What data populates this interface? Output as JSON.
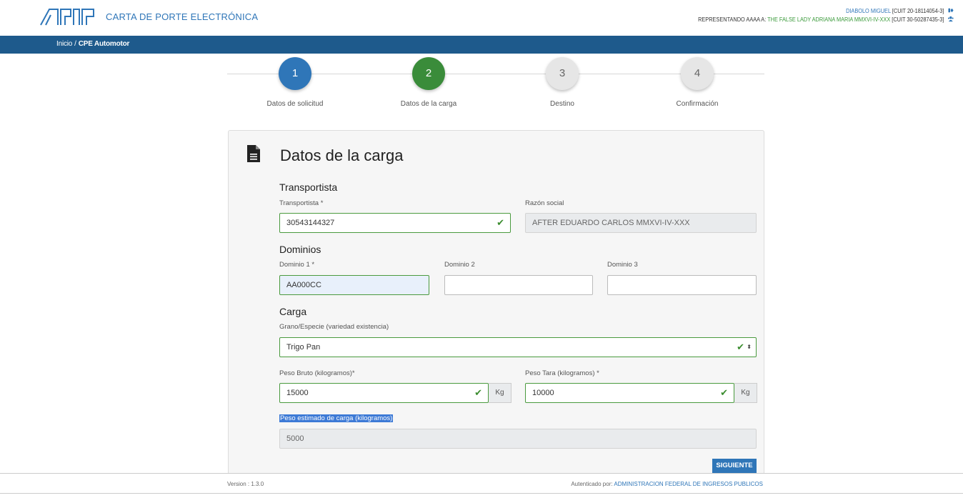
{
  "header": {
    "app_title": "CARTA DE PORTE ELECTRÓNICA",
    "user_name": "DIABOLO MIGUEL",
    "user_cuit": "[CUIT 20-18114054-3]",
    "representing_label": "REPRESENTANDO AAAA A:",
    "represented_name": "THE FALSE LADY ADRIANA MARIA MMXVI-IV-XXX",
    "represented_cuit": "[CUIT 30-50287435-3]",
    "logout_icon": "logout-icon",
    "users_icon": "users-icon"
  },
  "breadcrumb": {
    "home": "Inicio",
    "separator": "/",
    "current": "CPE Automotor"
  },
  "steps": [
    {
      "number": "1",
      "label": "Datos de solicitud",
      "color": "#2f76b8",
      "state": "done"
    },
    {
      "number": "2",
      "label": "Datos de la carga",
      "color": "#3a8c3a",
      "state": "active"
    },
    {
      "number": "3",
      "label": "Destino",
      "color": "#e6e6e6",
      "state": "pending"
    },
    {
      "number": "4",
      "label": "Confirmación",
      "color": "#e6e6e6",
      "state": "pending"
    }
  ],
  "form": {
    "title": "Datos de la carga",
    "transportista": {
      "section": "Transportista",
      "cuit_label": "Transportista *",
      "cuit_value": "30543144327",
      "razon_label": "Razón social",
      "razon_value": "AFTER EDUARDO CARLOS MMXVI-IV-XXX"
    },
    "dominios": {
      "section": "Dominios",
      "d1_label": "Dominio 1 *",
      "d1_value": "AA000CC",
      "d2_label": "Dominio 2",
      "d2_value": "",
      "d3_label": "Dominio 3",
      "d3_value": ""
    },
    "carga": {
      "section": "Carga",
      "grano_label": "Grano/Especie (variedad existencia)",
      "grano_value": "Trigo Pan",
      "bruto_label": "Peso Bruto (kilogramos)*",
      "bruto_value": "15000",
      "tara_label": "Peso Tara (kilogramos) *",
      "tara_value": "10000",
      "unit": "Kg",
      "estimado_label": "Peso estimado de carga (kilogramos)",
      "estimado_value": "5000"
    },
    "next_button": "SIGUIENTE"
  },
  "footer": {
    "version": "Version : 1.3.0",
    "auth_label": "Autenticado por:",
    "auth_org": "ADMINISTRACION FEDERAL DE INGRESOS PUBLICOS"
  },
  "colors": {
    "brand_blue": "#2f76b8",
    "navbar": "#1e5a8c",
    "valid_green": "#4a9a3e"
  }
}
